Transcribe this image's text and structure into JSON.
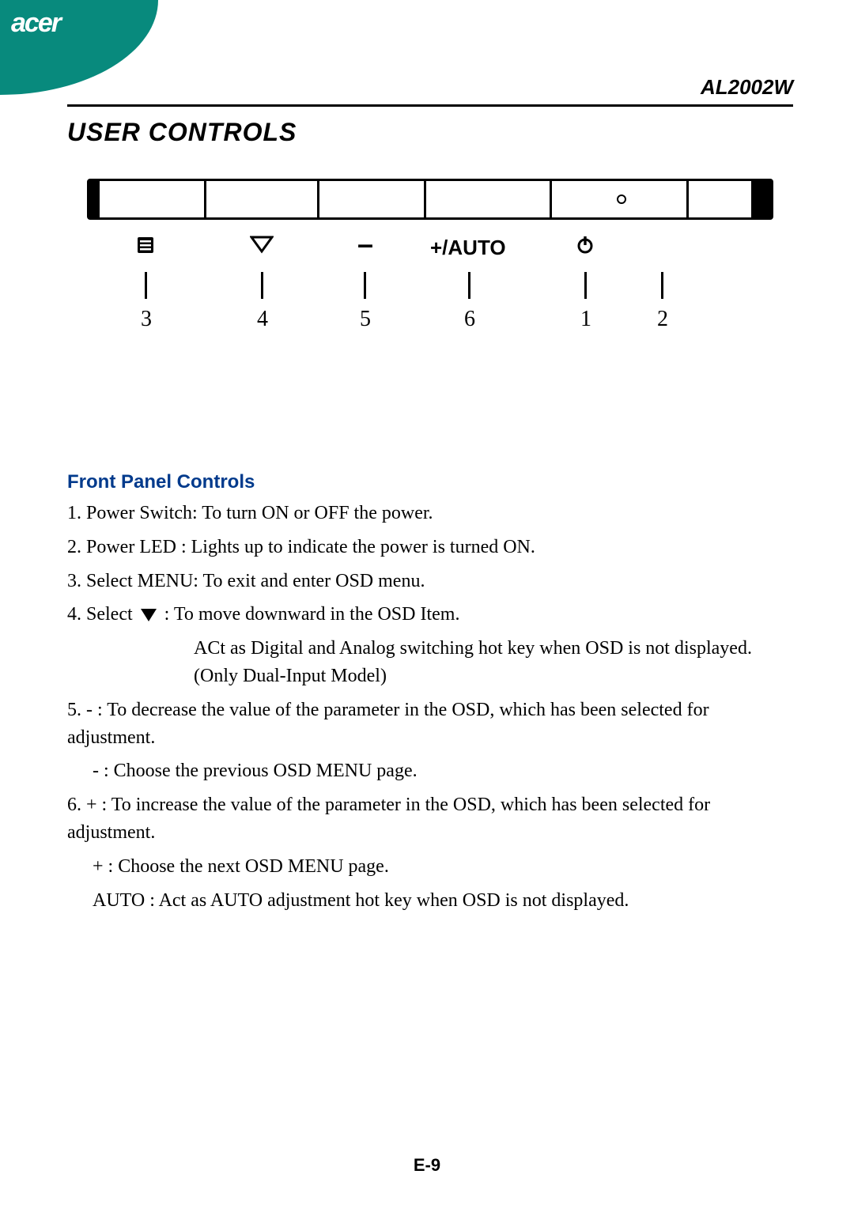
{
  "brand": "acer",
  "model": "AL2002W",
  "title": "USER CONTROLS",
  "panel": {
    "buttons": {
      "menu_icon": "menu-icon",
      "down_icon": "down-triangle-icon",
      "minus_label": "–",
      "plus_auto_label": "+/AUTO",
      "power_icon": "power-icon"
    },
    "callout_numbers": {
      "menu": "3",
      "down": "4",
      "minus": "5",
      "plus_auto": "6",
      "power": "1",
      "led": "2"
    }
  },
  "subhead": "Front Panel Controls",
  "items": {
    "i1": "1.  Power Switch: To turn ON or OFF the power.",
    "i2": "2.  Power LED     :  Lights up to indicate the power is turned ON.",
    "i3": "3.   Select MENU:        To exit and enter OSD menu.",
    "i4a_prefix": "4.   Select ",
    "i4a_suffix": "       :        To move downward in the OSD Item.",
    "i4b": "ACt as Digital and Analog switching hot key when OSD is not displayed.(Only Dual-Input Model)",
    "i5a": "5.   -                        :        To decrease the value of the parameter in the OSD, which has been selected for adjustment.",
    "i5b": "-             :   Choose the previous OSD MENU page.",
    "i6a": "6.   +          :   To increase the value of the parameter in the OSD, which has been selected for adjustment.",
    "i6b": "+            :   Choose the next OSD MENU page.",
    "i6c": "AUTO  :   Act as AUTO adjustment hot key when OSD is not displayed."
  },
  "page_number": "E-9"
}
